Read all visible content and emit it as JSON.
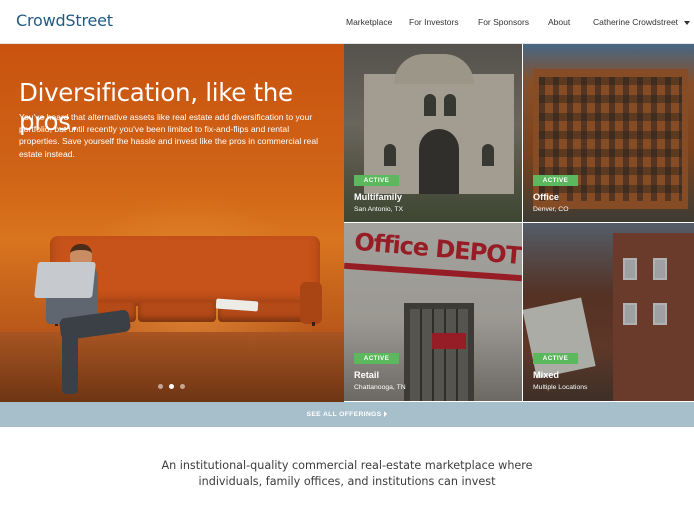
{
  "header": {
    "logo": "CrowdStreet",
    "nav": [
      "Marketplace",
      "For Investors",
      "For Sponsors",
      "About",
      "Catherine Crowdstreet"
    ]
  },
  "hero": {
    "title": "Diversification, like the pros.",
    "body": "You've heard that alternative assets like real estate add diversification to your portfolio, but until recently you've been limited to fix-and-flips and rental properties. Save yourself the hassle and invest like the pros in commercial real estate instead.",
    "carousel_active_index": 1,
    "carousel_count": 3
  },
  "offerings": [
    {
      "status": "ACTIVE",
      "type": "Multifamily",
      "location": "San Antonio, TX"
    },
    {
      "status": "ACTIVE",
      "type": "Office",
      "location": "Denver, CO"
    },
    {
      "status": "ACTIVE",
      "type": "Retail",
      "location": "Chattanooga, TN"
    },
    {
      "status": "ACTIVE",
      "type": "Mixed",
      "location": "Multiple Locations"
    }
  ],
  "retail_sign": "Office DEPOT",
  "see_all": "SEE ALL OFFERINGS",
  "tagline": "An institutional-quality commercial real-estate marketplace where individuals, family offices, and institutions can invest",
  "colors": {
    "brand": "#1f5b82",
    "active_badge": "#5cb85c",
    "see_all_bar": "#a7bfcb",
    "hero_orange": "#cf6316"
  }
}
